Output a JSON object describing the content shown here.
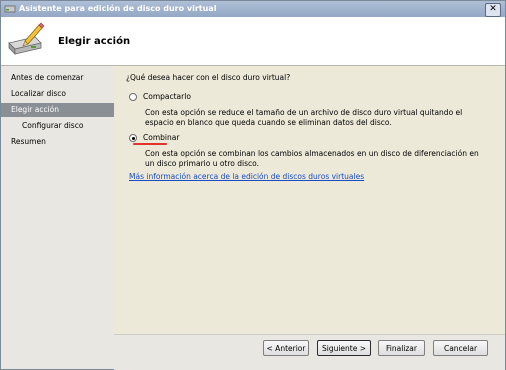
{
  "window": {
    "title": "Asistente para edición de disco duro virtual",
    "close_label": "✕"
  },
  "header": {
    "title": "Elegir acción"
  },
  "sidebar": {
    "items": [
      {
        "label": "Antes de comenzar",
        "active": false
      },
      {
        "label": "Localizar disco",
        "active": false
      },
      {
        "label": "Elegir acción",
        "active": true
      },
      {
        "label": "Configurar disco",
        "active": false
      },
      {
        "label": "Resumen",
        "active": false
      }
    ]
  },
  "main": {
    "question": "¿Qué desea hacer con el disco duro virtual?",
    "options": [
      {
        "label": "Compactarlo",
        "selected": false,
        "description": "Con esta opción se reduce el tamaño de un archivo de disco duro virtual quitando el espacio en blanco que queda cuando se eliminan datos del disco."
      },
      {
        "label": "Combinar",
        "selected": true,
        "description": "Con esta opción se combinan los cambios almacenados en un disco de diferenciación en un disco primario u otro disco."
      }
    ],
    "more_info_link": "Más información acerca de la edición de discos duros virtuales"
  },
  "buttons": {
    "previous": "< Anterior",
    "next": "Siguiente >",
    "finish": "Finalizar",
    "cancel": "Cancelar"
  },
  "colors": {
    "accent_underline": "#e2322f",
    "link": "#1a4cc7",
    "sidebar_active": "#8a8f95"
  }
}
